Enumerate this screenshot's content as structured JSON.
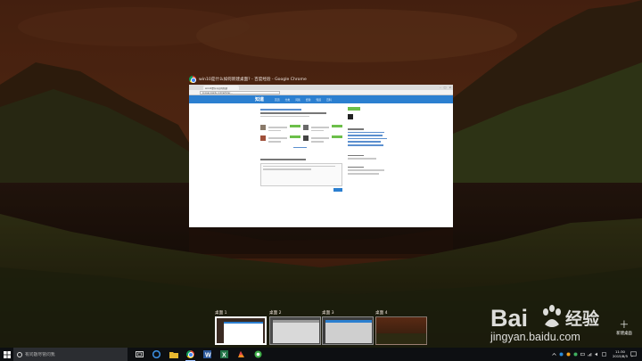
{
  "window": {
    "title": "win10是什么如何新建桌面? - 百度经验 - Google Chrome",
    "browser": {
      "tab_title": "win10是什么如何新建",
      "url": "jingyan.baidu.com/article/...",
      "site_logo": "知道",
      "nav_items": [
        "首页",
        "分类",
        "问答",
        "经验",
        "知道",
        "百科"
      ]
    }
  },
  "desktops": [
    {
      "label": "桌面 1",
      "active": true
    },
    {
      "label": "桌面 2",
      "active": false
    },
    {
      "label": "桌面 3",
      "active": false
    },
    {
      "label": "桌面 4",
      "active": false
    }
  ],
  "new_desktop": {
    "plus": "+",
    "label": "新建桌面"
  },
  "watermark": {
    "brand": "Bai",
    "brand_cn": "经验",
    "url": "jingyan.baidu.com"
  },
  "taskbar": {
    "search_placeholder": "有问题尽管问我",
    "pinned": [
      "task-view-icon",
      "edge-icon",
      "file-explorer-icon",
      "chrome-icon",
      "word-icon",
      "excel-icon",
      "paint-icon",
      "360-browser-icon"
    ],
    "clock_time": "11:30",
    "clock_date": "2015/8/5"
  }
}
